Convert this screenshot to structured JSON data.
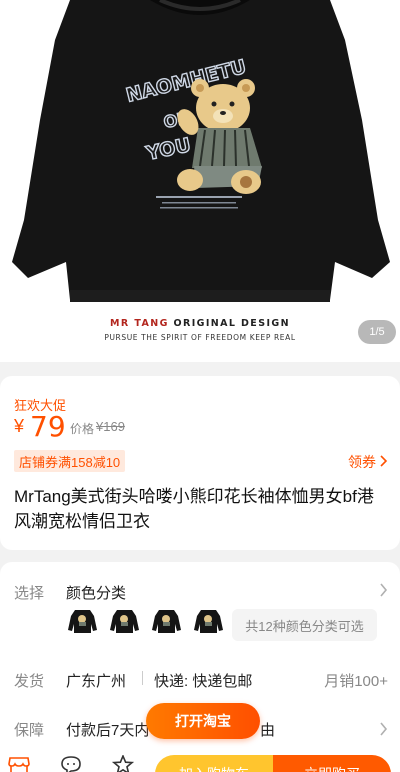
{
  "hero": {
    "print_text": "NAOMHETU OF YOU",
    "brand_prefix": "MR TANG",
    "brand_suffix": "ORIGINAL DESIGN",
    "tagline": "PURSUE THE SPIRIT OF FREEDOM KEEP REAL",
    "image_counter": "1/5"
  },
  "price": {
    "promo_label": "狂欢大促",
    "currency": "¥",
    "current": "79",
    "original_label": "价格",
    "original": "¥169",
    "coupon": "店铺券满158减10",
    "claim_label": "领券",
    "accent_color": "#ff5000"
  },
  "product": {
    "title": "MrTang美式街头哈喽小熊印花长袖体恤男女bf港风潮宽松情侣卫衣"
  },
  "spec": {
    "select_label": "选择",
    "select_value": "颜色分类",
    "more_colors": "共12种颜色分类可选",
    "ship_label": "发货",
    "ship_from": "广东广州",
    "ship_method": "快递: 快递包邮",
    "monthly_sales": "月销100+",
    "guarantee_label": "保障",
    "guarantee_value": "付款后7天内",
    "guarantee_tail": "由"
  },
  "actions": {
    "open_app": "打开淘宝",
    "add_to_cart": "加入购物车",
    "buy_now": "立即购买"
  },
  "icons": [
    "store-icon",
    "chat-icon",
    "star-icon",
    "chevron-right-icon"
  ]
}
